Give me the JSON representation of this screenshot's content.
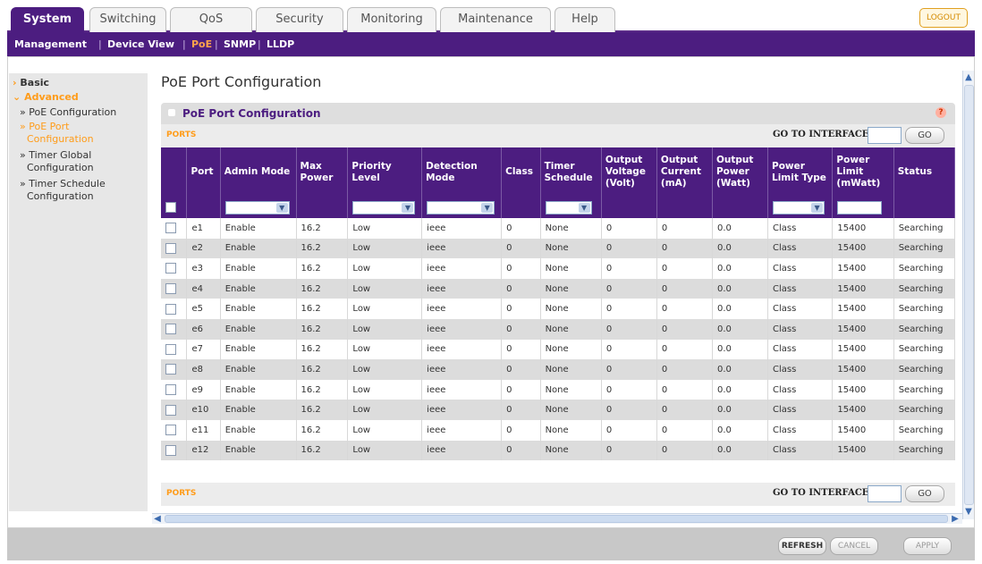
{
  "nav": {
    "tabs": [
      {
        "label": "System",
        "active": true
      },
      {
        "label": "Switching",
        "active": false
      },
      {
        "label": "QoS",
        "active": false
      },
      {
        "label": "Security",
        "active": false
      },
      {
        "label": "Monitoring",
        "active": false
      },
      {
        "label": "Maintenance",
        "active": false
      },
      {
        "label": "Help",
        "active": false
      }
    ],
    "logout": "LOGOUT",
    "subnav": [
      "Management",
      "Device View",
      "PoE",
      "SNMP",
      "LLDP"
    ],
    "subnav_active": "PoE"
  },
  "sidebar": {
    "basic": "Basic",
    "advanced": "Advanced",
    "items": [
      "PoE Configuration",
      "PoE Port Configuration",
      "Timer Global Configuration",
      "Timer Schedule Configuration"
    ],
    "item_lines": {
      "poe_config": "PoE Configuration",
      "poe_port_1": "PoE Port",
      "poe_port_2": "Configuration",
      "timer_global_1": "Timer Global",
      "timer_global_2": "Configuration",
      "timer_sched_1": "Timer Schedule",
      "timer_sched_2": "Configuration"
    },
    "active_item": "PoE Port Configuration"
  },
  "main": {
    "page_title": "PoE Port Configuration",
    "panel_title": "PoE Port Configuration",
    "help_icon": "?",
    "ports_label": "PORTS",
    "goto_label": "GO TO INTERFACE",
    "go_button": "GO"
  },
  "table": {
    "headers": [
      "",
      "Port",
      "Admin Mode",
      "Max Power",
      "Priority Level",
      "Detection Mode",
      "Class",
      "Timer Schedule",
      "Output Voltage (Volt)",
      "Output Current (mA)",
      "Output Power (Watt)",
      "Power Limit Type",
      "Power Limit (mWatt)",
      "Status"
    ],
    "rows": [
      [
        "e1",
        "Enable",
        "16.2",
        "Low",
        "ieee",
        "0",
        "None",
        "0",
        "0",
        "0.0",
        "Class",
        "15400",
        "Searching"
      ],
      [
        "e2",
        "Enable",
        "16.2",
        "Low",
        "ieee",
        "0",
        "None",
        "0",
        "0",
        "0.0",
        "Class",
        "15400",
        "Searching"
      ],
      [
        "e3",
        "Enable",
        "16.2",
        "Low",
        "ieee",
        "0",
        "None",
        "0",
        "0",
        "0.0",
        "Class",
        "15400",
        "Searching"
      ],
      [
        "e4",
        "Enable",
        "16.2",
        "Low",
        "ieee",
        "0",
        "None",
        "0",
        "0",
        "0.0",
        "Class",
        "15400",
        "Searching"
      ],
      [
        "e5",
        "Enable",
        "16.2",
        "Low",
        "ieee",
        "0",
        "None",
        "0",
        "0",
        "0.0",
        "Class",
        "15400",
        "Searching"
      ],
      [
        "e6",
        "Enable",
        "16.2",
        "Low",
        "ieee",
        "0",
        "None",
        "0",
        "0",
        "0.0",
        "Class",
        "15400",
        "Searching"
      ],
      [
        "e7",
        "Enable",
        "16.2",
        "Low",
        "ieee",
        "0",
        "None",
        "0",
        "0",
        "0.0",
        "Class",
        "15400",
        "Searching"
      ],
      [
        "e8",
        "Enable",
        "16.2",
        "Low",
        "ieee",
        "0",
        "None",
        "0",
        "0",
        "0.0",
        "Class",
        "15400",
        "Searching"
      ],
      [
        "e9",
        "Enable",
        "16.2",
        "Low",
        "ieee",
        "0",
        "None",
        "0",
        "0",
        "0.0",
        "Class",
        "15400",
        "Searching"
      ],
      [
        "e10",
        "Enable",
        "16.2",
        "Low",
        "ieee",
        "0",
        "None",
        "0",
        "0",
        "0.0",
        "Class",
        "15400",
        "Searching"
      ],
      [
        "e11",
        "Enable",
        "16.2",
        "Low",
        "ieee",
        "0",
        "None",
        "0",
        "0",
        "0.0",
        "Class",
        "15400",
        "Searching"
      ],
      [
        "e12",
        "Enable",
        "16.2",
        "Low",
        "ieee",
        "0",
        "None",
        "0",
        "0",
        "0.0",
        "Class",
        "15400",
        "Searching"
      ]
    ]
  },
  "footer": {
    "refresh": "REFRESH",
    "cancel": "CANCEL",
    "apply": "APPLY"
  },
  "colors": {
    "brand_purple": "#4c1d80",
    "accent_orange": "#ff9c1a",
    "row_alt": "#dcdcdc"
  }
}
